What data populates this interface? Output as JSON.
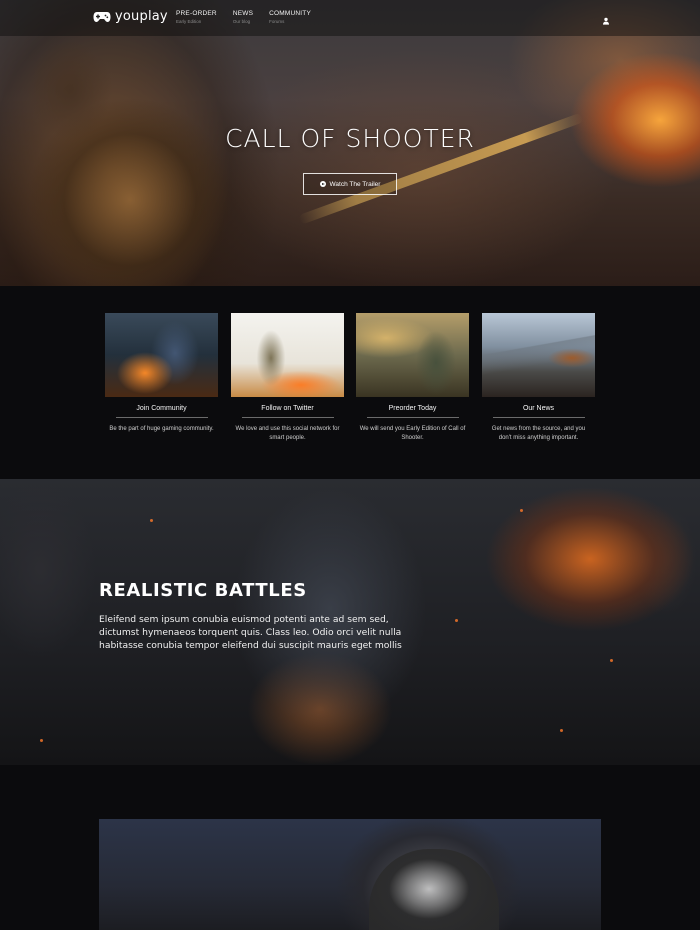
{
  "nav": {
    "logo_text": "youplay",
    "items": [
      {
        "label": "PRE-ORDER",
        "sub": "Early Edition"
      },
      {
        "label": "NEWS",
        "sub": "Our blog"
      },
      {
        "label": "COMMUNITY",
        "sub": "Forums"
      }
    ],
    "icons": {
      "logo": "gamepad-icon",
      "user": "user-icon"
    }
  },
  "hero": {
    "title": "CALL OF SHOOTER",
    "button_label": "Watch The Trailer",
    "button_icon": "play-icon"
  },
  "features": [
    {
      "title": "Join Community",
      "desc": "Be the part of huge gaming community."
    },
    {
      "title": "Follow on Twitter",
      "desc": "We love and use this social network for smart people."
    },
    {
      "title": "Preorder Today",
      "desc": "We will send you Early Edition of Call of Shooter."
    },
    {
      "title": "Our News",
      "desc": "Get news from the source, and you don't miss anything important."
    }
  ],
  "battles": {
    "heading": "REALISTIC BATTLES",
    "text": "Eleifend sem ipsum conubia euismod potenti ante ad sem sed, dictumst hymenaeos torquent quis. Class leo. Odio orci velit nulla habitasse conubia tempor eleifend dui suscipit mauris eget mollis"
  },
  "colors": {
    "background": "#0d0d0f",
    "text": "#ffffff",
    "accent_fire": "#ff7a2a",
    "muted_text": "#cfcfcf"
  }
}
